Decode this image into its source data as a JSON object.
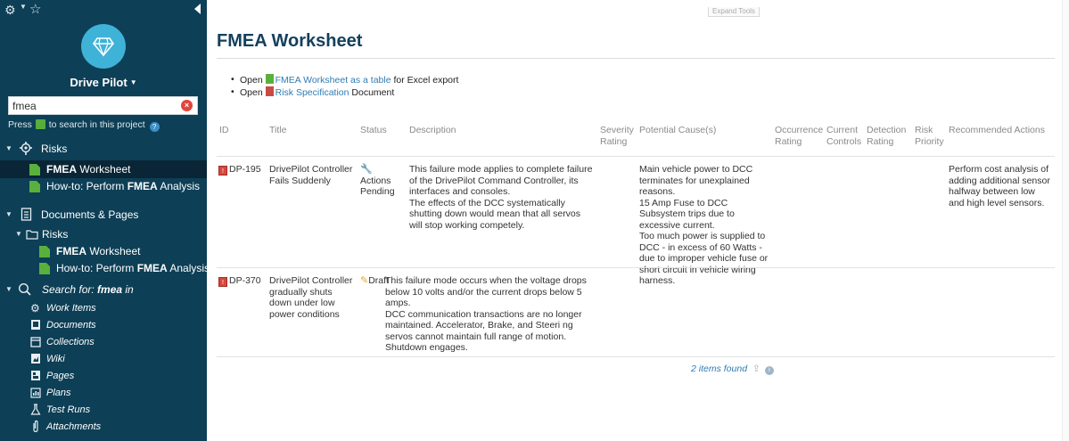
{
  "sidebar": {
    "project_title": "Drive Pilot",
    "search_value": "fmea",
    "press_hint_prefix": "Press",
    "press_hint_suffix": "to search in this project",
    "items": [
      {
        "label": "Risks"
      },
      {
        "label_bold": "FMEA",
        "label_rest": " Worksheet"
      },
      {
        "label_prefix": "How-to: Perform ",
        "label_bold": "FMEA",
        "label_rest": " Analysis"
      },
      {
        "label": "Documents & Pages"
      },
      {
        "label": "Risks"
      },
      {
        "label_bold": "FMEA",
        "label_rest": " Worksheet"
      },
      {
        "label_prefix": "How-to: Perform ",
        "label_bold": "FMEA",
        "label_rest": " Analysis"
      },
      {
        "label_prefix": "Search for: ",
        "label_bold": "fmea",
        "label_rest": " in"
      }
    ],
    "search_scopes": [
      "Work Items",
      "Documents",
      "Collections",
      "Wiki",
      "Pages",
      "Plans",
      "Test Runs",
      "Attachments"
    ]
  },
  "main": {
    "expand_tools": "Expand Tools",
    "title": "FMEA Worksheet",
    "links": [
      {
        "prefix": "Open ",
        "link": "FMEA Worksheet as a table",
        "suffix": " for Excel export"
      },
      {
        "prefix": "Open ",
        "link": "Risk Specification",
        "suffix": " Document"
      }
    ],
    "columns": [
      "ID",
      "Title",
      "Status",
      "Description",
      "Severity Rating",
      "Potential Cause(s)",
      "Occurrence Rating",
      "Current Controls",
      "Detection Rating",
      "Risk Priority",
      "Recommended Actions"
    ],
    "rows": [
      {
        "id": "DP-195",
        "title": "DrivePilot Controller Fails Suddenly",
        "status": "Actions Pending",
        "description": "This failure mode applies to complete failure of the DrivePilot Command Controller, its interfaces and consoles.\nThe effects of the DCC systematically shutting down would mean that all servos will stop working competely.",
        "causes": "Main vehicle power to DCC terminates for unexplained reasons.\n15 Amp Fuse to DCC Subsystem trips due to excessive current.\nToo much power is supplied to DCC - in excess of 60 Watts - due to improper vehicle fuse or short circuit in vehicle wiring harness.",
        "actions": "Perform cost analysis of adding additional sensor halfway between low and high level sensors."
      },
      {
        "id": "DP-370",
        "title": "DrivePilot Controller gradually shuts down under low power conditions",
        "status": "Draft",
        "description": "This failure mode occurs when the voltage drops below 10 volts and/or the current drops below 5 amps.\nDCC communication transactions are no longer maintained. Accelerator, Brake, and Steeri ng servos cannot maintain full range of motion.\nShutdown engages.",
        "causes": "",
        "actions": ""
      }
    ],
    "items_found": "2 items found"
  }
}
